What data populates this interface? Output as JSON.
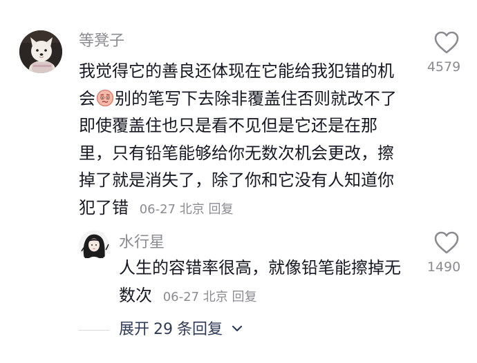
{
  "comment": {
    "author": "等凳子",
    "lines": [
      "我觉得它的善良还体现在它能给我犯错的机",
      "会",
      "别的笔写下去除非覆盖住否则就改不了",
      "即使覆盖住也只是看不见但是它还是在那",
      "里，只有铅笔能够给你无数次机会更改，擦",
      "掉了就是消失了，除了你和它没有人知道你",
      "犯了错"
    ],
    "emoji": "anxious-face-emoji",
    "date": "06-27",
    "location": "北京",
    "reply_label": "回复",
    "like_count": "4579",
    "like_icon": "heart-outline-icon"
  },
  "reply": {
    "author": "水行星",
    "lines": [
      "人生的容错率很高，就像铅笔能擦掉无",
      "数次"
    ],
    "date": "06-27",
    "location": "北京",
    "reply_label": "回复",
    "like_count": "1490",
    "like_icon": "heart-outline-icon"
  },
  "expand": {
    "prefix": "展开",
    "count": "29",
    "suffix": "条回复",
    "chevron_icon": "chevron-down-icon"
  },
  "colors": {
    "text_primary": "#161823",
    "text_secondary": "#8a8b91",
    "expand_text": "#2f3a57"
  }
}
